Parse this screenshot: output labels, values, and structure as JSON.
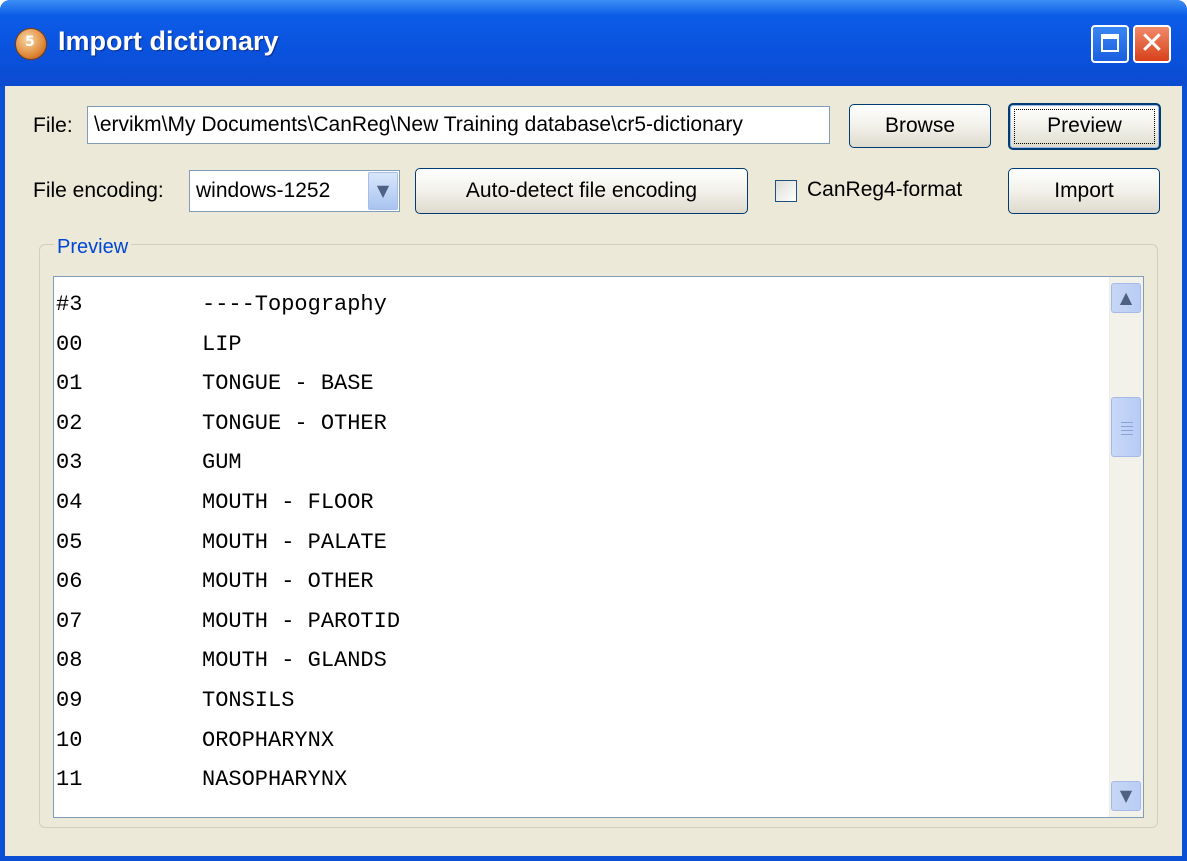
{
  "window": {
    "title": "Import dictionary"
  },
  "file_row": {
    "label": "File:",
    "path_value": "\\ervikm\\My Documents\\CanReg\\New Training database\\cr5-dictionary",
    "browse_label": "Browse",
    "preview_label": "Preview"
  },
  "encoding_row": {
    "label": "File encoding:",
    "selected": "windows-1252",
    "auto_detect_label": "Auto-detect file encoding",
    "canreg4_label": "CanReg4-format",
    "canreg4_checked": false,
    "import_label": "Import"
  },
  "preview": {
    "group_title": "Preview",
    "lines": [
      {
        "code": "#3",
        "name": "----Topography"
      },
      {
        "code": "00",
        "name": "LIP"
      },
      {
        "code": "01",
        "name": "TONGUE - BASE"
      },
      {
        "code": "02",
        "name": "TONGUE - OTHER"
      },
      {
        "code": "03",
        "name": "GUM"
      },
      {
        "code": "04",
        "name": "MOUTH - FLOOR"
      },
      {
        "code": "05",
        "name": "MOUTH - PALATE"
      },
      {
        "code": "06",
        "name": "MOUTH - OTHER"
      },
      {
        "code": "07",
        "name": "MOUTH - PAROTID"
      },
      {
        "code": "08",
        "name": "MOUTH - GLANDS"
      },
      {
        "code": "09",
        "name": "TONSILS"
      },
      {
        "code": "10",
        "name": "OROPHARYNX"
      },
      {
        "code": "11",
        "name": "NASOPHARYNX"
      }
    ]
  },
  "icons": {
    "app": "canreg-app-icon",
    "maximize": "maximize-icon",
    "close": "close-icon",
    "dropdown": "chevron-down-icon",
    "scroll_up": "chevron-up-icon",
    "scroll_down": "chevron-down-icon"
  },
  "colors": {
    "titlebar": "#0a52dd",
    "dialog_bg": "#ece9d8",
    "group_title": "#0046d5"
  }
}
